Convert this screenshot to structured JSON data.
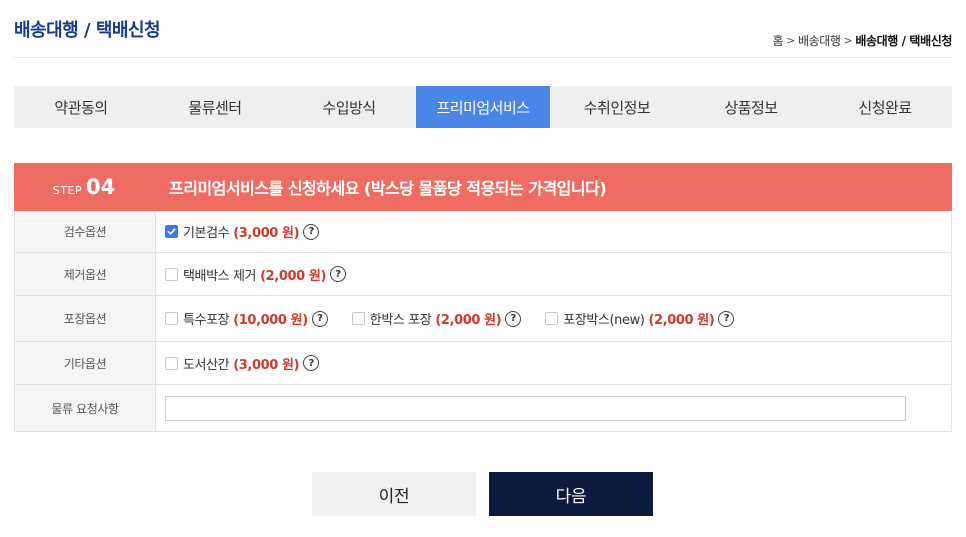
{
  "header": {
    "title": "배송대행 / 택배신청",
    "breadcrumb": [
      {
        "label": "홈"
      },
      {
        "label": "배송대행"
      },
      {
        "label": "배송대행 / 택배신청",
        "current": true
      }
    ]
  },
  "tabs": [
    {
      "label": "약관동의"
    },
    {
      "label": "물류센터"
    },
    {
      "label": "수입방식"
    },
    {
      "label": "프리미엄서비스",
      "active": true
    },
    {
      "label": "수취인정보"
    },
    {
      "label": "상품정보"
    },
    {
      "label": "신청완료"
    }
  ],
  "step": {
    "word": "STEP",
    "number": "04",
    "title": "프리미엄서비스를 신청하세요 (박스당 물품당 적용되는 가격입니다)"
  },
  "options": [
    {
      "label": "검수옵션",
      "items": [
        {
          "name": "기본검수",
          "price": "(3,000 원)",
          "checked": true
        }
      ]
    },
    {
      "label": "제거옵션",
      "items": [
        {
          "name": "택배박스 제거",
          "price": "(2,000 원)",
          "checked": false
        }
      ]
    },
    {
      "label": "포장옵션",
      "items": [
        {
          "name": "특수포장",
          "price": "(10,000 원)",
          "checked": false
        },
        {
          "name": "한박스 포장",
          "price": "(2,000 원)",
          "checked": false
        },
        {
          "name": "포장박스(new)",
          "price": "(2,000 원)",
          "checked": false
        }
      ]
    },
    {
      "label": "기타옵션",
      "items": [
        {
          "name": "도서산간",
          "price": "(3,000 원)",
          "checked": false
        }
      ]
    }
  ],
  "request": {
    "label": "물류 요청사항",
    "value": ""
  },
  "buttons": {
    "prev": "이전",
    "next": "다음"
  },
  "icons": {
    "help": "?",
    "check": "check-icon",
    "breadcrumb_separator": ">"
  },
  "colors": {
    "title": "#1a3a8c",
    "active_tab": "#4a86e8",
    "step_header": "#ef6c62",
    "price": "#d03a2e",
    "next_button": "#0b1a3d"
  }
}
